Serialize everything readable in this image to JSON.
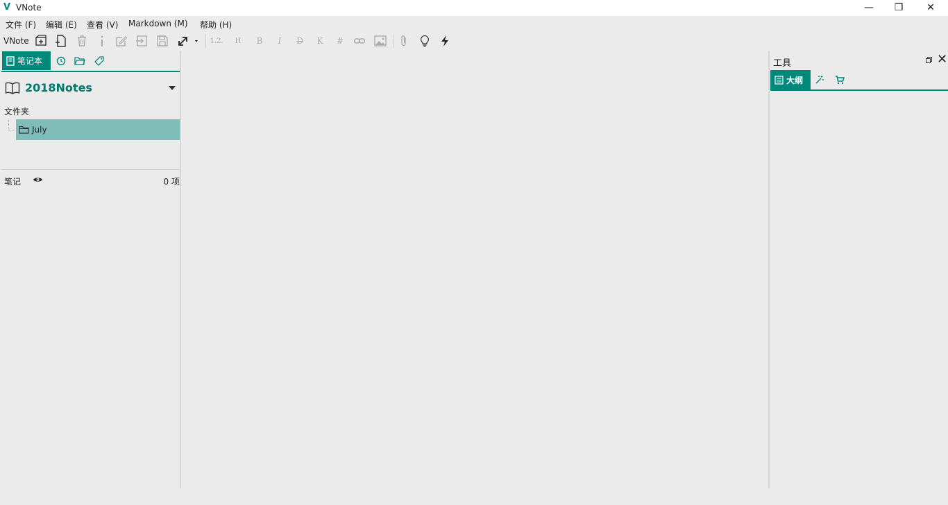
{
  "window": {
    "logo": "V",
    "title": "VNote",
    "controls": {
      "minimize": "—",
      "maximize": "❐",
      "close": "✕"
    }
  },
  "menu": [
    "文件 (F)",
    "编辑 (E)",
    "查看 (V)",
    "Markdown (M)",
    "帮助 (H)"
  ],
  "toolbar": {
    "label": "VNote",
    "icons": [
      "new-notebook-icon",
      "new-note-icon",
      "delete-icon",
      "info-icon",
      "edit-icon",
      "move-icon",
      "save-icon",
      "expand-icon",
      "heading-sequence",
      "heading",
      "bold",
      "italic",
      "strikethrough",
      "inline-code",
      "code-block",
      "link-icon",
      "image-icon",
      "attachment-icon",
      "lightbulb-icon",
      "flash-icon"
    ],
    "heading_sequence": "1.2.",
    "heading": "H",
    "bold": "B",
    "italic": "I",
    "strikethrough": "D",
    "inline_code": "K",
    "code_block": "#"
  },
  "left_panel": {
    "tabs": [
      {
        "label": "笔记本",
        "icon": "notebook-icon",
        "active": true
      },
      {
        "label": "",
        "icon": "history-icon",
        "active": false
      },
      {
        "label": "",
        "icon": "explorer-icon",
        "active": false
      },
      {
        "label": "",
        "icon": "tag-icon",
        "active": false
      }
    ],
    "notebook": {
      "name": "2018Notes",
      "icon": "book-icon"
    },
    "folders_label": "文件夹",
    "folders": [
      {
        "name": "July",
        "selected": true
      }
    ],
    "notes_label": "笔记",
    "notes_count": "0 项"
  },
  "right_panel": {
    "title": "工具",
    "tabs": [
      {
        "label": "大纲",
        "icon": "outline-icon",
        "active": true
      },
      {
        "label": "",
        "icon": "snippet-icon",
        "active": false
      },
      {
        "label": "",
        "icon": "cart-icon",
        "active": false
      }
    ]
  },
  "colors": {
    "accent": "#00897b",
    "selection": "#80bcb8",
    "background": "#ebebeb"
  }
}
